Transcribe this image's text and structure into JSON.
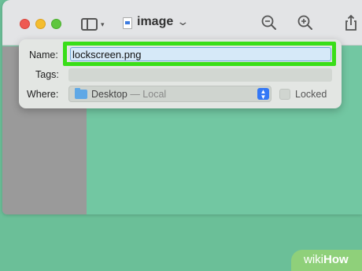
{
  "window": {
    "title": "image",
    "toolbar_icons": [
      "sidebar-toggle-icon",
      "zoom-out-icon",
      "zoom-in-icon",
      "share-icon"
    ]
  },
  "save_popover": {
    "name_label": "Name:",
    "name_value": "lockscreen.png",
    "tags_label": "Tags:",
    "tags_value": "",
    "where_label": "Where:",
    "where_value": "Desktop",
    "where_sub": " — Local",
    "locked_label": "Locked",
    "locked_checked": false
  },
  "colors": {
    "background": "#6bbf98",
    "highlight": "#39de18",
    "accent": "#3478f6"
  },
  "watermark": {
    "text_light": "wiki",
    "text_bold": "How"
  }
}
